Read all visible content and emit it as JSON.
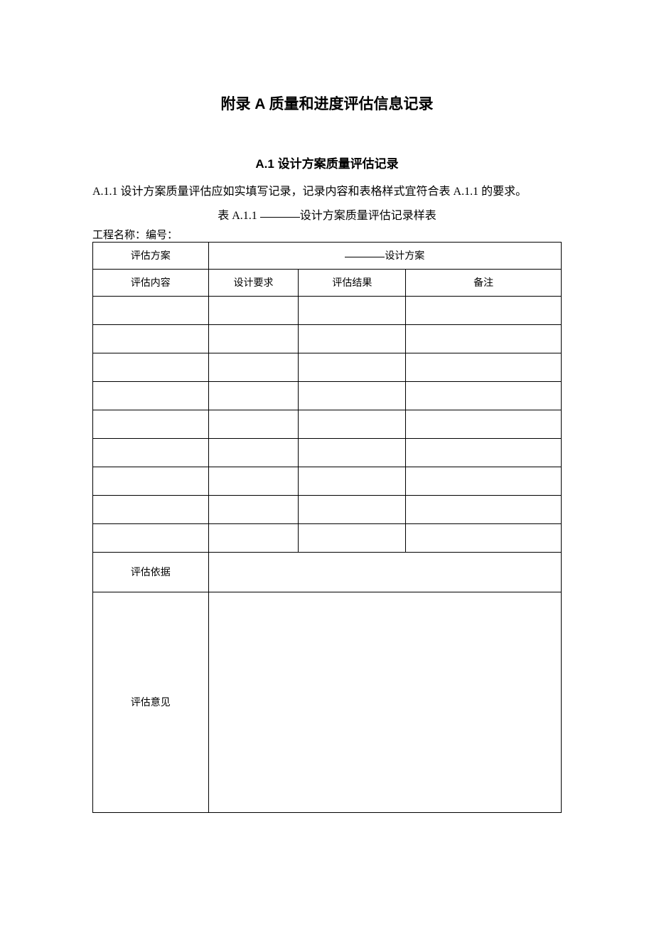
{
  "title": "附录 A 质量和进度评估信息记录",
  "section": {
    "heading": "A.1 设计方案质量评估记录",
    "paragraph_prefix": "A.1.1 设计方案质量评估应如实填写记录，记录内容和表格样式宜符合表 A.1.1 的要求。",
    "caption_prefix": "表 A.1.1 ",
    "caption_suffix": "设计方案质量评估记录样表"
  },
  "project_label": "工程名称：编号：",
  "table": {
    "row1_left": "评估方案",
    "row1_right": "设计方案",
    "headers": {
      "content": "评估内容",
      "req": "设计要求",
      "result": "评估结果",
      "remark": "备注"
    },
    "basis_label": "评估依据",
    "opinion_label": "评估意见",
    "empty_rows": 9
  }
}
